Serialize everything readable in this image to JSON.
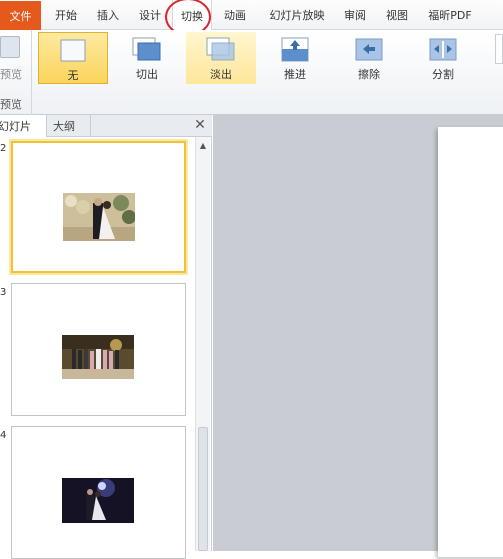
{
  "menu": {
    "file": "文件",
    "tabs": [
      "开始",
      "插入",
      "设计",
      "切换",
      "动画",
      "幻灯片放映",
      "审阅",
      "视图",
      "福昕PDF"
    ]
  },
  "ribbon": {
    "preview_label": "预览",
    "group_label": "预览",
    "effects": [
      {
        "label": "无",
        "icon": "none-transition-icon"
      },
      {
        "label": "切出",
        "icon": "cut-transition-icon"
      },
      {
        "label": "淡出",
        "icon": "fade-transition-icon"
      },
      {
        "label": "推进",
        "icon": "push-transition-icon"
      },
      {
        "label": "擦除",
        "icon": "wipe-transition-icon"
      },
      {
        "label": "分割",
        "icon": "split-transition-icon"
      }
    ]
  },
  "panel": {
    "tab_slides": "幻灯片",
    "tab_outline": "大纲",
    "close": "✕"
  },
  "slides": [
    {
      "number": "2",
      "photo": "wedding-couple-photo"
    },
    {
      "number": "3",
      "photo": "wedding-group-photo"
    },
    {
      "number": "4",
      "photo": "wedding-night-photo"
    }
  ],
  "colors": {
    "file_tab": "#e55a1c",
    "selected_effect": "#fbd45c",
    "annotation_circle": "#d8262d"
  }
}
